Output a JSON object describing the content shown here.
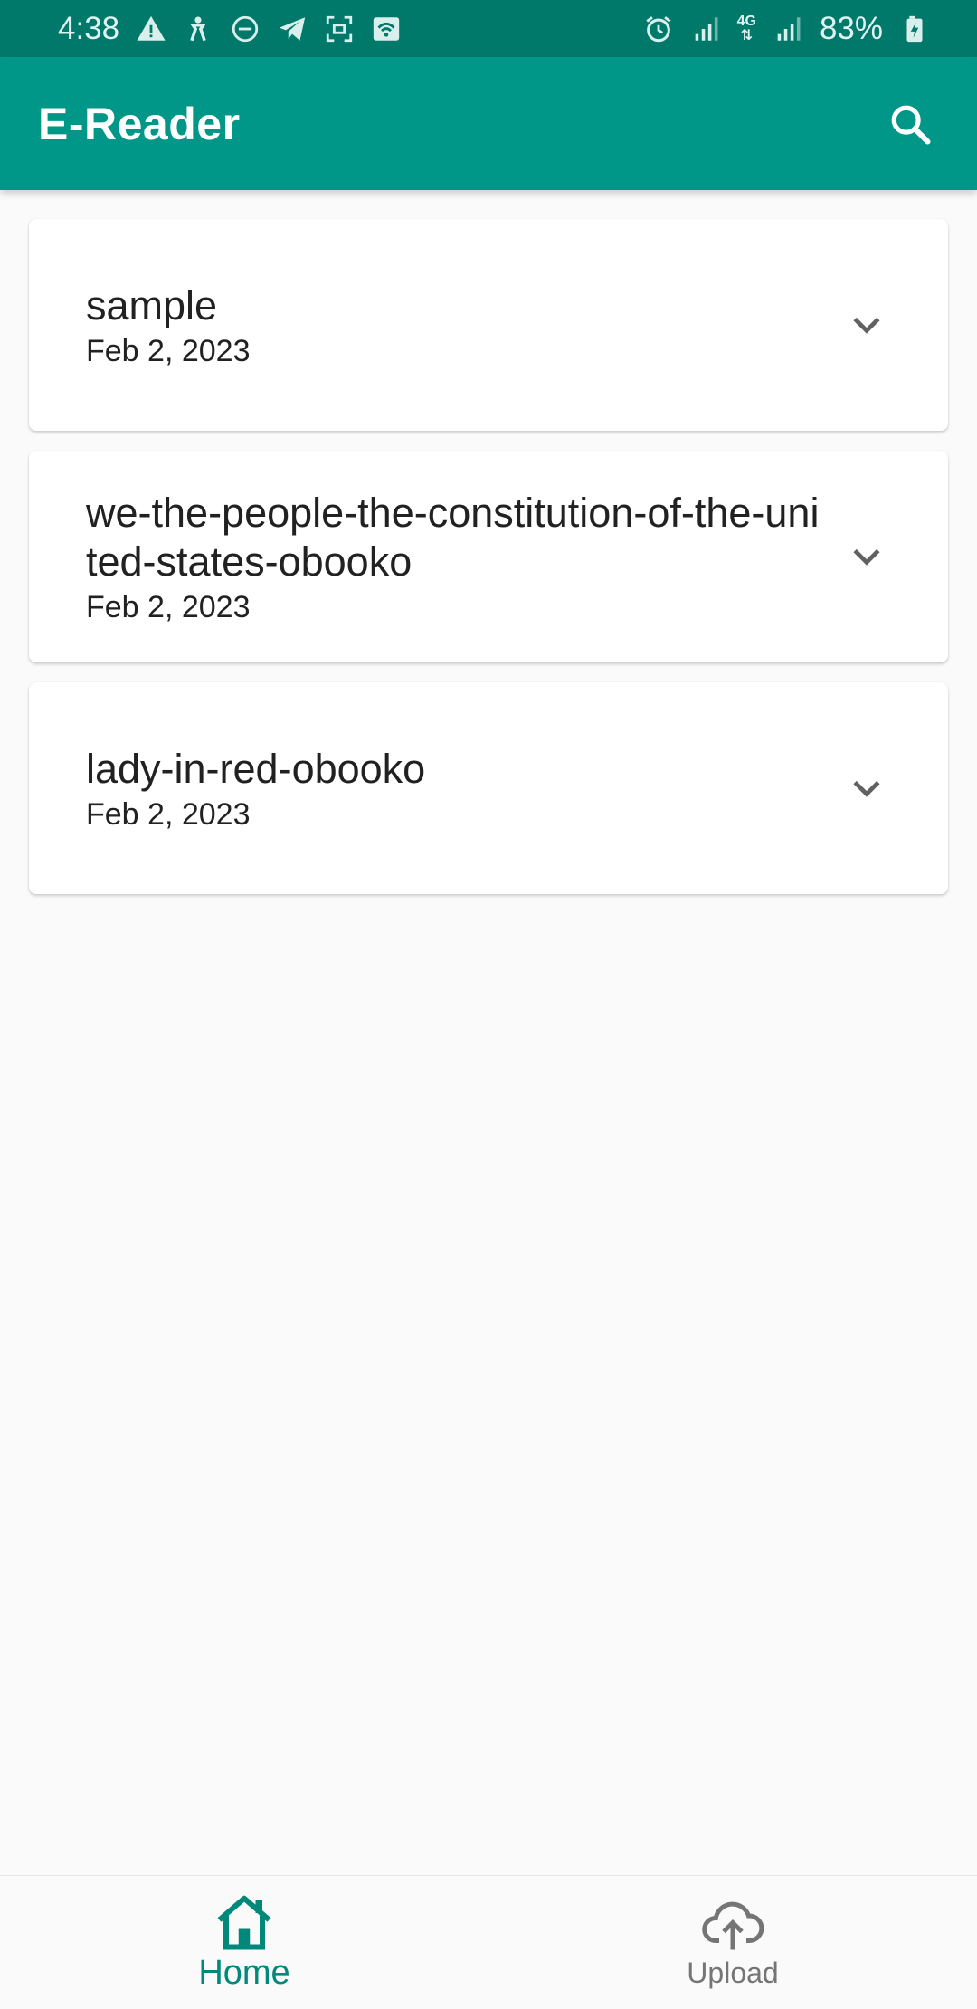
{
  "status_bar": {
    "time": "4:38",
    "battery": "83%",
    "network": "4G",
    "left_icons": [
      "warning-icon",
      "accessibility-icon",
      "do-not-disturb-icon",
      "telegram-icon",
      "screenshot-icon",
      "wifi-hotspot-icon"
    ],
    "right_icons": [
      "alarm-icon",
      "signal-icon",
      "signal-4g-icon",
      "battery-charging-icon"
    ]
  },
  "app_bar": {
    "title": "E-Reader",
    "action_icon": "search-icon"
  },
  "books": [
    {
      "title": "sample",
      "date": "Feb 2, 2023"
    },
    {
      "title": "we-the-people-the-constitution-of-the-united-states-obooko",
      "date": "Feb 2, 2023"
    },
    {
      "title": "lady-in-red-obooko",
      "date": "Feb 2, 2023"
    }
  ],
  "bottom_nav": {
    "items": [
      {
        "label": "Home",
        "icon": "home-icon",
        "active": true
      },
      {
        "label": "Upload",
        "icon": "cloud-upload-icon",
        "active": false
      }
    ]
  },
  "colors": {
    "status_bar": "#00796b",
    "app_bar": "#009688",
    "background": "#fafafa",
    "active_nav": "#00897b",
    "inactive_nav": "#757575"
  }
}
